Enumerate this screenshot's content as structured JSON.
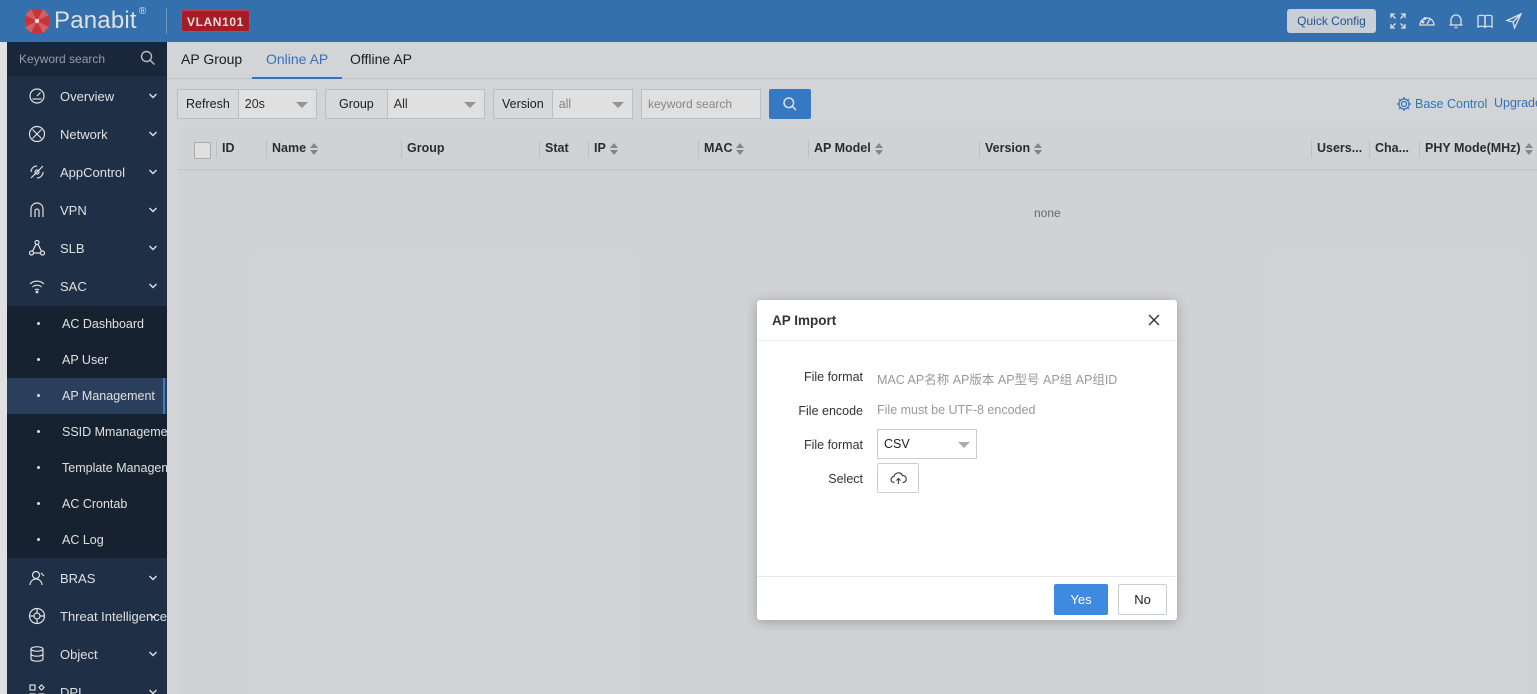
{
  "header": {
    "brand": "Panabit",
    "brand_mark": "®",
    "vlan_badge": "VLAN101",
    "quick_config": "Quick Config",
    "icons": [
      "fullscreen-icon",
      "dashboard-icon",
      "bell-icon",
      "book-icon",
      "send-icon"
    ]
  },
  "sidebar": {
    "search_placeholder": "Keyword search",
    "items": [
      {
        "label": "Overview",
        "icon": "gauge-icon"
      },
      {
        "label": "Network",
        "icon": "network-icon"
      },
      {
        "label": "AppControl",
        "icon": "appcontrol-icon"
      },
      {
        "label": "VPN",
        "icon": "vpn-icon"
      },
      {
        "label": "SLB",
        "icon": "slb-icon"
      },
      {
        "label": "SAC",
        "icon": "wifi-icon"
      }
    ],
    "sub_items": [
      {
        "label": "AC Dashboard"
      },
      {
        "label": "AP User"
      },
      {
        "label": "AP Management",
        "active": true
      },
      {
        "label": "SSID Mmanagement"
      },
      {
        "label": "Template Management"
      },
      {
        "label": "AC Crontab"
      },
      {
        "label": "AC Log"
      }
    ],
    "items_bottom": [
      {
        "label": "BRAS",
        "icon": "user-icon"
      },
      {
        "label": "Threat Intelligence",
        "icon": "threat-icon"
      },
      {
        "label": "Object",
        "icon": "database-icon"
      },
      {
        "label": "DPI",
        "icon": "dpi-icon"
      }
    ]
  },
  "tabs": [
    {
      "label": "AP Group"
    },
    {
      "label": "Online AP",
      "active": true
    },
    {
      "label": "Offline AP"
    }
  ],
  "filters": {
    "refresh_label": "Refresh",
    "refresh_value": "20s",
    "group_label": "Group",
    "group_value": "All",
    "version_label": "Version",
    "version_value": "all",
    "keyword_placeholder": "keyword search",
    "base_control": "Base Control",
    "upgrade": "Upgrade"
  },
  "table": {
    "columns": [
      "ID",
      "Name",
      "Group",
      "Stat",
      "IP",
      "MAC",
      "AP Model",
      "Version",
      "Users...",
      "Cha...",
      "PHY Mode(MHz)"
    ],
    "empty_text": "none"
  },
  "modal": {
    "title": "AP Import",
    "rows": [
      {
        "label": "File format",
        "value": "MAC AP名称 AP版本 AP型号 AP组 AP组ID"
      },
      {
        "label": "File encode",
        "value": "File must be UTF-8 encoded"
      },
      {
        "label": "File format",
        "value": "CSV"
      },
      {
        "label": "Select",
        "value": ""
      }
    ],
    "yes": "Yes",
    "no": "No"
  },
  "colors": {
    "topbar": "#3c7fc7",
    "sidebar": "#24364f",
    "accent": "#3d8ae0",
    "vlan_badge": "#c0222b"
  }
}
